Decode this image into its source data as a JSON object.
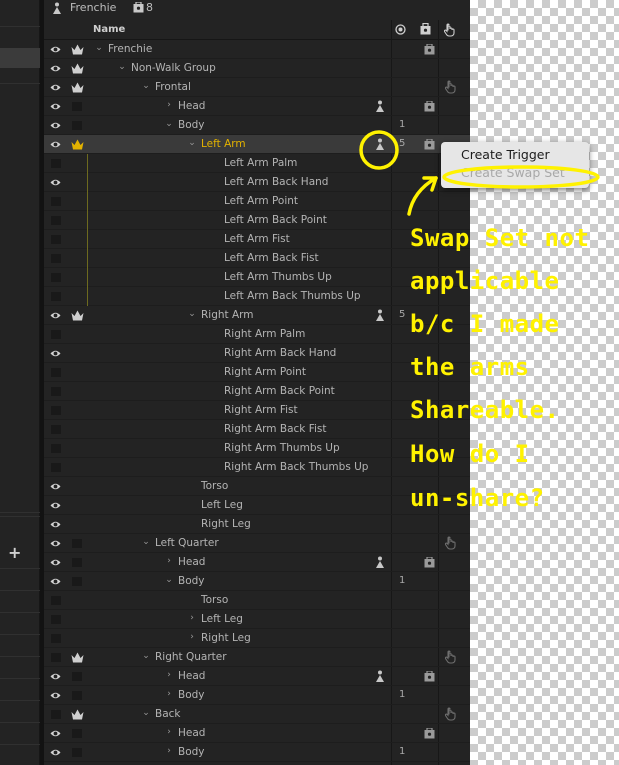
{
  "title_bar": {
    "name": "Frenchie",
    "count": "8"
  },
  "columns": {
    "name": "Name"
  },
  "rows": [
    {
      "label": "Frenchie",
      "depth": 0,
      "chev": "down",
      "eye": true,
      "crown": true,
      "bag": true
    },
    {
      "label": "Non-Walk Group",
      "depth": 1,
      "chev": "down",
      "eye": true,
      "crown": true
    },
    {
      "label": "Frontal",
      "depth": 2,
      "chev": "down",
      "eye": true,
      "crown": true,
      "hand": true
    },
    {
      "label": "Head",
      "depth": 3,
      "chev": "right",
      "eye": true,
      "box": true,
      "pup": true,
      "bag": true
    },
    {
      "label": "Body",
      "depth": 3,
      "chev": "down",
      "eye": true,
      "box": true,
      "num": "1"
    },
    {
      "label": "Left Arm",
      "depth": 4,
      "chev": "down",
      "eye": true,
      "crown": true,
      "pup": true,
      "num": "5",
      "bag": true,
      "sel": true
    },
    {
      "label": "Left Arm Palm",
      "depth": 5,
      "guide": true,
      "eyebox": true
    },
    {
      "label": "Left Arm Back Hand",
      "depth": 5,
      "guide": true,
      "eye": true
    },
    {
      "label": "Left Arm Point",
      "depth": 5,
      "guide": true,
      "eyebox": true
    },
    {
      "label": "Left Arm Back Point",
      "depth": 5,
      "guide": true,
      "eyebox": true
    },
    {
      "label": "Left Arm Fist",
      "depth": 5,
      "guide": true,
      "eyebox": true
    },
    {
      "label": "Left Arm Back Fist",
      "depth": 5,
      "guide": true,
      "eyebox": true
    },
    {
      "label": "Left Arm Thumbs Up",
      "depth": 5,
      "guide": true,
      "eyebox": true
    },
    {
      "label": "Left Arm Back Thumbs Up",
      "depth": 5,
      "guide": true,
      "eyebox": true
    },
    {
      "label": "Right Arm",
      "depth": 4,
      "chev": "down",
      "eye": true,
      "crown": true,
      "pup": true,
      "num": "5"
    },
    {
      "label": "Right Arm Palm",
      "depth": 5,
      "eyebox": true
    },
    {
      "label": "Right Arm Back Hand",
      "depth": 5,
      "eye": true
    },
    {
      "label": "Right Arm Point",
      "depth": 5,
      "eyebox": true
    },
    {
      "label": "Right Arm Back Point",
      "depth": 5,
      "eyebox": true
    },
    {
      "label": "Right Arm Fist",
      "depth": 5,
      "eyebox": true
    },
    {
      "label": "Right Arm Back Fist",
      "depth": 5,
      "eyebox": true
    },
    {
      "label": "Right Arm Thumbs Up",
      "depth": 5,
      "eyebox": true
    },
    {
      "label": "Right Arm Back Thumbs Up",
      "depth": 5,
      "eyebox": true
    },
    {
      "label": "Torso",
      "depth": 4,
      "eye": true
    },
    {
      "label": "Left Leg",
      "depth": 4,
      "eye": true
    },
    {
      "label": "Right Leg",
      "depth": 4,
      "eye": true
    },
    {
      "label": "Left Quarter",
      "depth": 2,
      "chev": "down",
      "eye": true,
      "box": true,
      "hand": true
    },
    {
      "label": "Head",
      "depth": 3,
      "chev": "right",
      "eye": true,
      "box": true,
      "pup": true,
      "bag": true
    },
    {
      "label": "Body",
      "depth": 3,
      "chev": "down",
      "eye": true,
      "box": true,
      "num": "1"
    },
    {
      "label": "Torso",
      "depth": 4,
      "eyebox": true
    },
    {
      "label": "Left Leg",
      "depth": 4,
      "chev": "right",
      "eyebox": true
    },
    {
      "label": "Right Leg",
      "depth": 4,
      "chev": "right",
      "eyebox": true
    },
    {
      "label": "Right Quarter",
      "depth": 2,
      "chev": "down",
      "eyebox": true,
      "crown": true,
      "hand": true
    },
    {
      "label": "Head",
      "depth": 3,
      "chev": "right",
      "eye": true,
      "box": true,
      "pup": true,
      "bag": true
    },
    {
      "label": "Body",
      "depth": 3,
      "chev": "right",
      "eye": true,
      "box": true,
      "num": "1"
    },
    {
      "label": "Back",
      "depth": 2,
      "chev": "down",
      "eyebox": true,
      "crown": true,
      "hand": true
    },
    {
      "label": "Head",
      "depth": 3,
      "chev": "right",
      "eye": true,
      "box": true,
      "bag": true
    },
    {
      "label": "Body",
      "depth": 3,
      "chev": "right",
      "eye": true,
      "box": true,
      "num": "1"
    }
  ],
  "menu": {
    "create_trigger": "Create Trigger",
    "create_swap_set": "Create Swap Set"
  },
  "annotation": {
    "lines": [
      "Swap Set not",
      "applicable",
      "b/c I made",
      "the arms",
      "Shareable.",
      "How do I",
      "un-share?"
    ],
    "color": "#fff200"
  }
}
